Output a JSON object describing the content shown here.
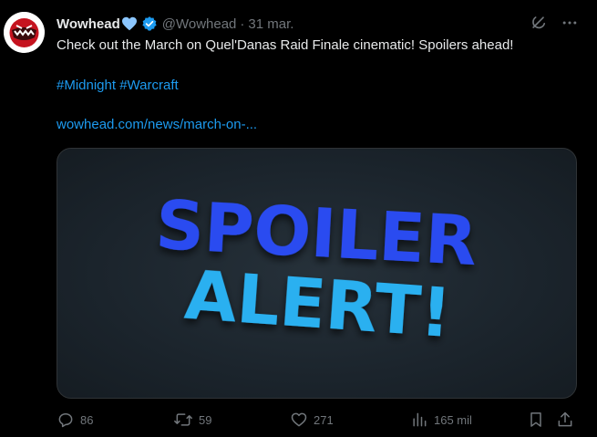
{
  "tweet": {
    "author_name": "Wowhead",
    "handle": "@Wowhead",
    "separator": "·",
    "date": "31 mar.",
    "text": "Check out the March on Quel'Danas Raid Finale cinematic! Spoilers ahead!",
    "hashtags": "#Midnight #Warcraft",
    "link_text": "wowhead.com/news/march-on-..."
  },
  "media": {
    "line1": "SPOILER",
    "line2": "ALERT!"
  },
  "actions": {
    "replies": "86",
    "reposts": "59",
    "likes": "271",
    "views": "165 mil"
  },
  "colors": {
    "background": "#000000",
    "text": "#e7e9ea",
    "muted": "#71767b",
    "link": "#1d9bf0",
    "spoiler_blue": "#2a4cf0",
    "alert_cyan": "#2bb0f0"
  },
  "icons": [
    "wowhead-logo",
    "heart-icon",
    "verified-badge-icon",
    "grok-icon",
    "more-icon",
    "reply-icon",
    "repost-icon",
    "like-icon",
    "views-icon",
    "bookmark-icon",
    "share-icon"
  ]
}
